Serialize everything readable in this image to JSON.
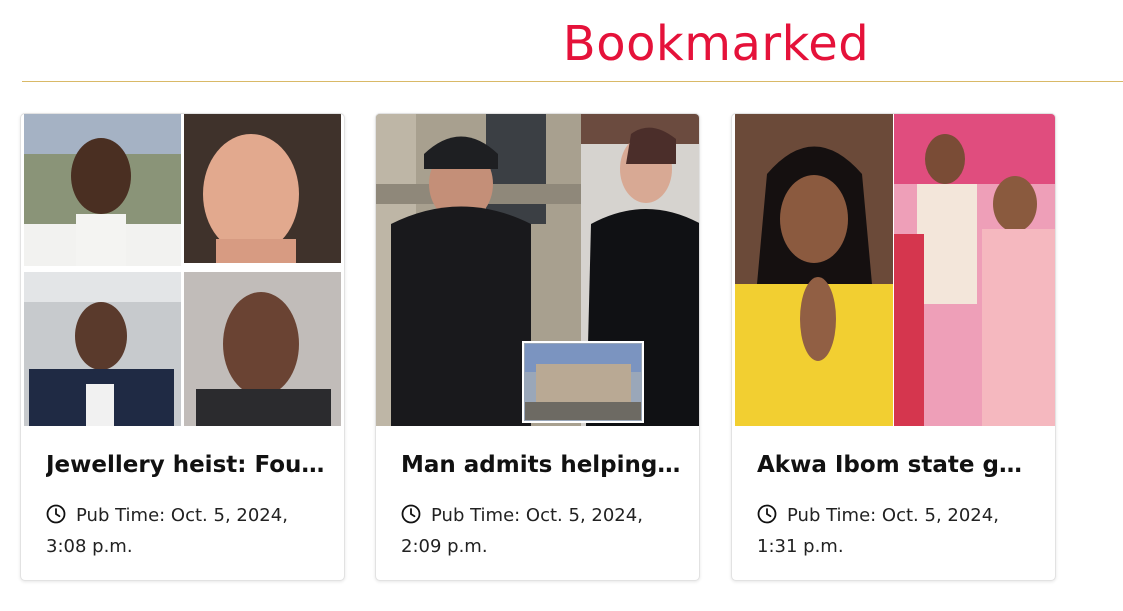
{
  "page": {
    "title": "Bookmarked",
    "accent_color": "#e5123a",
    "divider_color": "#d9b967"
  },
  "cards": [
    {
      "title": "Jewellery heist: Four S...",
      "pub_label": "Pub Time: Oct. 5, 2024,",
      "pub_time": "3:08 p.m.",
      "icon": "clock-icon"
    },
    {
      "title": "Man admits helping w...",
      "pub_label": "Pub Time: Oct. 5, 2024,",
      "pub_time": "2:09 p.m.",
      "icon": "clock-icon"
    },
    {
      "title": "Akwa Ibom state gov ...",
      "pub_label": "Pub Time: Oct. 5, 2024,",
      "pub_time": "1:31 p.m.",
      "icon": "clock-icon"
    }
  ]
}
